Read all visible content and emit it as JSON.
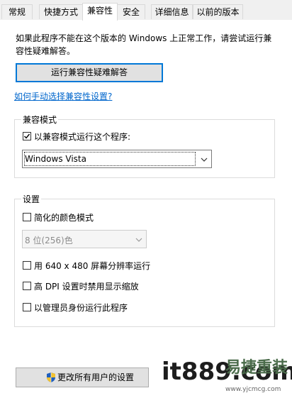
{
  "tabs": [
    {
      "label": "常规",
      "active": false
    },
    {
      "label": "快捷方式",
      "active": false
    },
    {
      "label": "兼容性",
      "active": true
    },
    {
      "label": "安全",
      "active": false
    },
    {
      "label": "详细信息",
      "active": false
    },
    {
      "label": "以前的版本",
      "active": false
    }
  ],
  "intro_text": "如果此程序不能在这个版本的 Windows 上正常工作，请尝试运行兼容性疑难解答。",
  "troubleshoot_button": "运行兼容性疑难解答",
  "manual_link": "如何手动选择兼容性设置?",
  "compat_group": {
    "title": "兼容模式",
    "checkbox_label": "以兼容模式运行这个程序:",
    "checked": true,
    "selected_os": "Windows Vista"
  },
  "settings_group": {
    "title": "设置",
    "reduced_color_label": "简化的颜色模式",
    "reduced_color_checked": false,
    "color_select_value": "8 位(256)色",
    "res_label": "用 640 x 480 屏幕分辨率运行",
    "res_checked": false,
    "dpi_label": "高 DPI 设置时禁用显示缩放",
    "dpi_checked": false,
    "admin_label": "以管理员身份运行此程序",
    "admin_checked": false
  },
  "all_users_button": "更改所有用户的设置",
  "watermark": {
    "brand": "it889.com",
    "cn": "易捷重装",
    "url": "www.yjcmcg.com"
  },
  "colors": {
    "accent": "#0078d7",
    "link": "#0066cc"
  }
}
